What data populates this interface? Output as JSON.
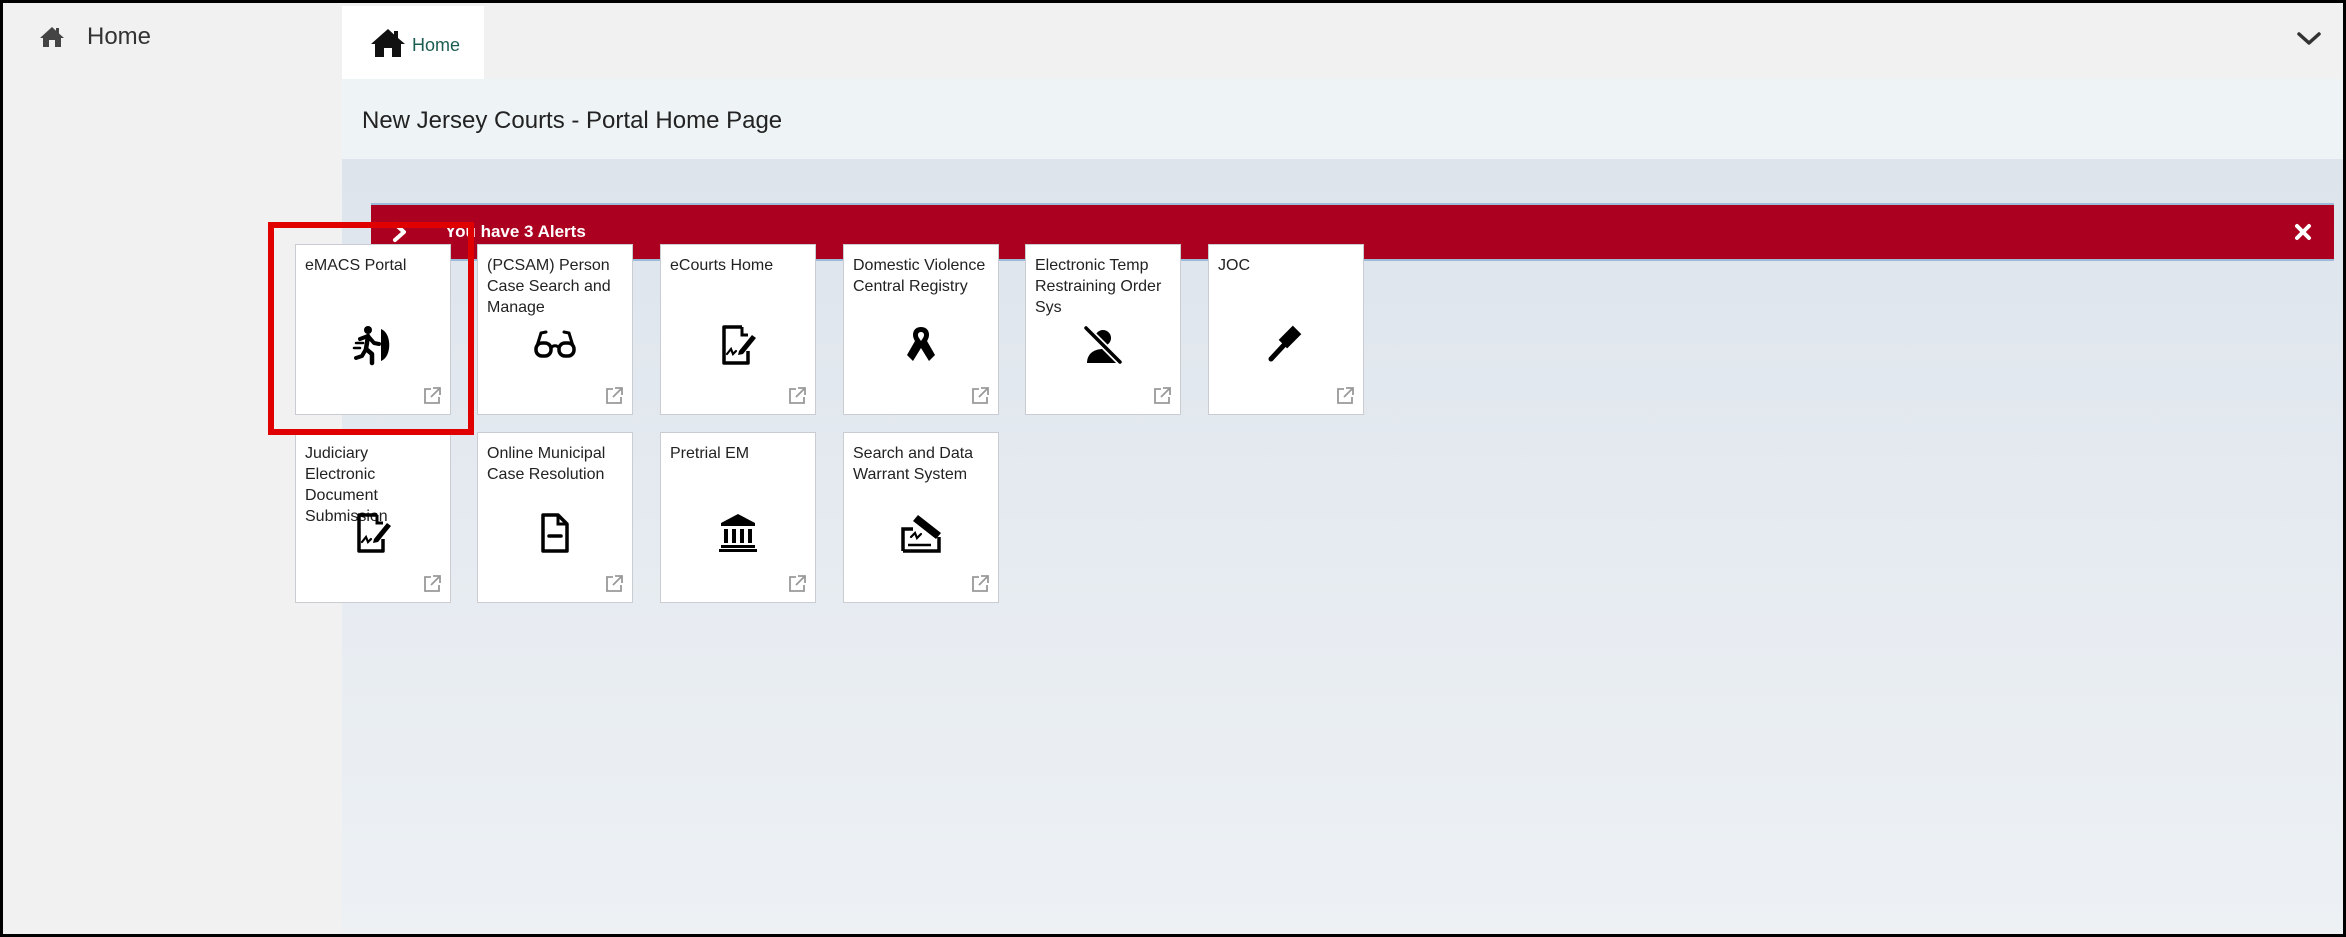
{
  "sidebar": {
    "home_label": "Home"
  },
  "breadcrumb": {
    "home_label": "Home"
  },
  "page": {
    "title": "New Jersey Courts - Portal Home Page"
  },
  "alert": {
    "text": "You have 3 Alerts"
  },
  "tiles": [
    {
      "title": "eMACS Portal",
      "icon": "running-exit-icon"
    },
    {
      "title": "(PCSAM) Person Case Search and Manage",
      "icon": "glasses-icon"
    },
    {
      "title": "eCourts Home",
      "icon": "signed-document-icon"
    },
    {
      "title": "Domestic Violence Central Registry",
      "icon": "awareness-ribbon-icon"
    },
    {
      "title": "Electronic Temp Restraining Order Sys",
      "icon": "person-blocked-icon"
    },
    {
      "title": "JOC",
      "icon": "gavel-icon"
    },
    {
      "title": "Judiciary Electronic Document Submission",
      "icon": "signed-document-icon"
    },
    {
      "title": "Online Municipal Case Resolution",
      "icon": "document-icon"
    },
    {
      "title": "Pretrial EM",
      "icon": "courthouse-icon"
    },
    {
      "title": "Search and Data Warrant System",
      "icon": "signing-icon"
    }
  ],
  "colors": {
    "alert_bg": "#ac0020",
    "highlight": "#e00000",
    "breadcrumb_text": "#1b5d52"
  }
}
